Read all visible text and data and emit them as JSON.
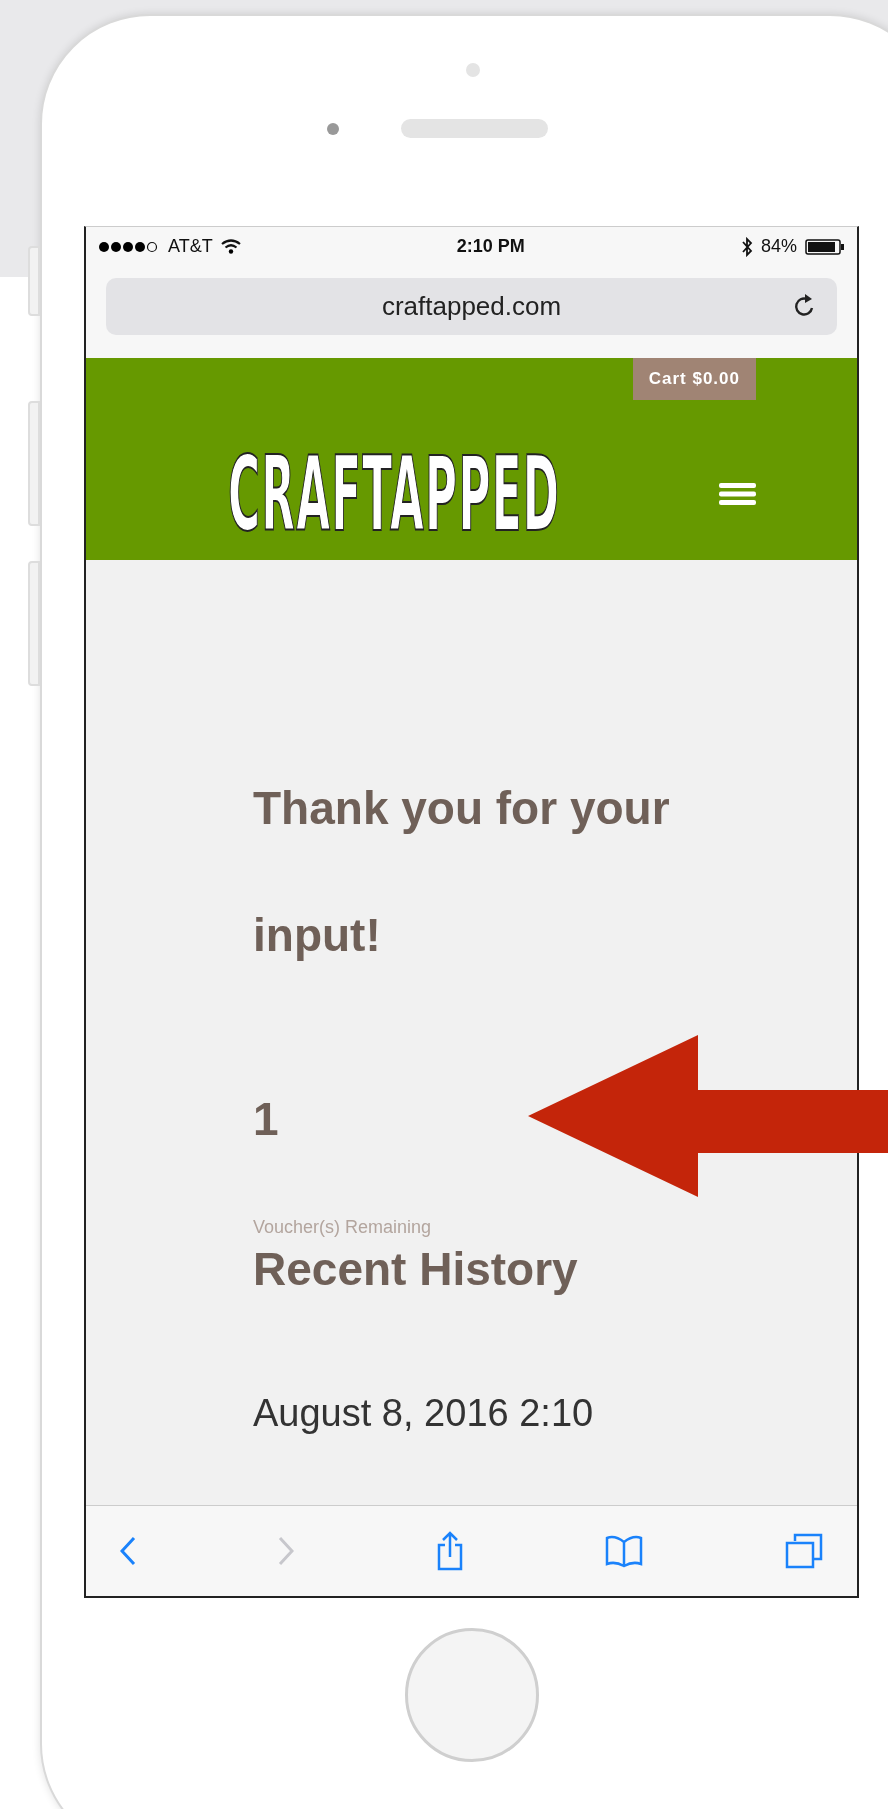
{
  "status_bar": {
    "carrier": "AT&T",
    "time": "2:10 PM",
    "battery": "84%"
  },
  "address_bar": {
    "url": "craftapped.com"
  },
  "header": {
    "cart": "Cart $0.00",
    "logo": "CRAFTAPPED"
  },
  "content": {
    "heading": "Thank you for your input!",
    "count": "1",
    "count_label": "Voucher(s) Remaining",
    "history_title": "Recent History",
    "history": [
      {
        "date": "August 8, 2016 2:10"
      }
    ]
  },
  "toolbar": [
    {
      "kind": "back",
      "disabled": false
    },
    {
      "kind": "forward",
      "disabled": true
    },
    {
      "kind": "share",
      "disabled": false
    },
    {
      "kind": "bookmarks",
      "disabled": false
    },
    {
      "kind": "tabs",
      "disabled": false
    }
  ]
}
